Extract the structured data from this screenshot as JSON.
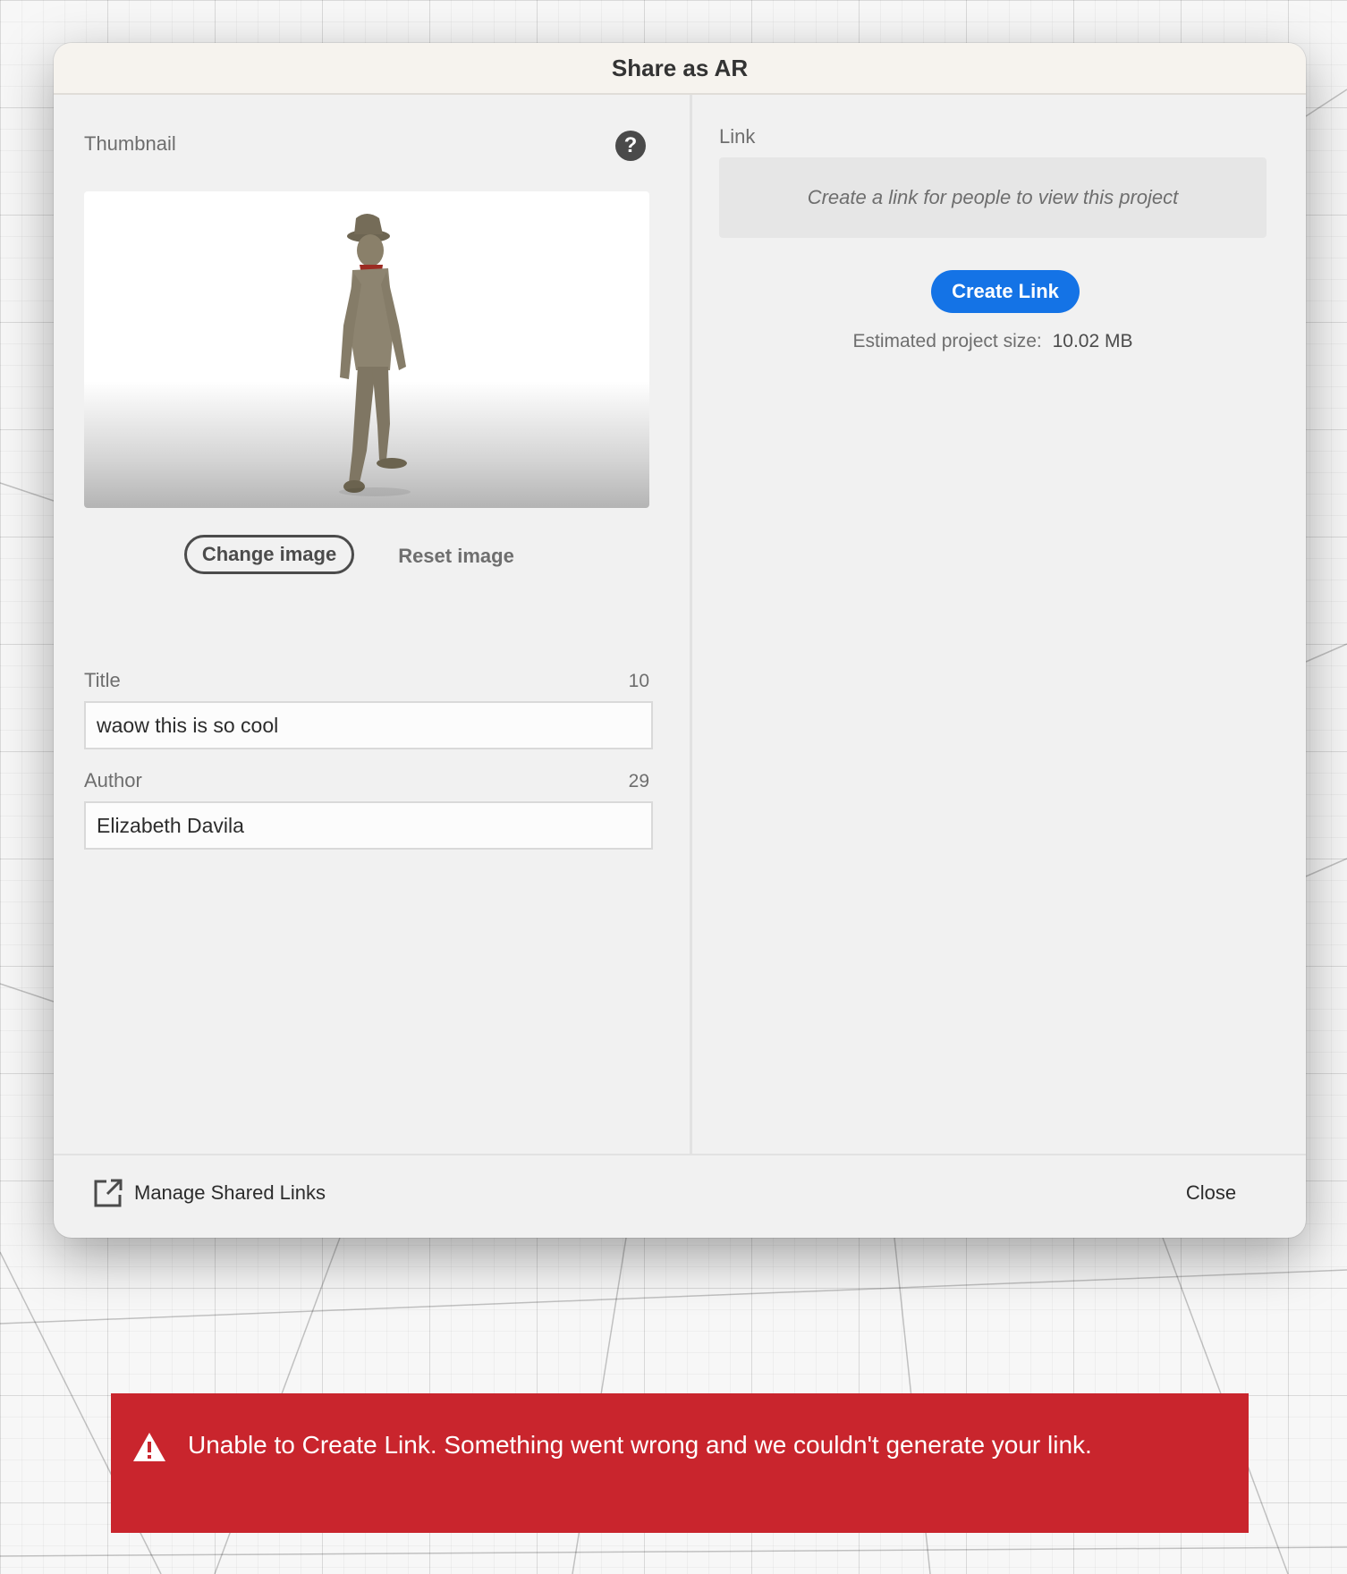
{
  "dialog": {
    "title": "Share as AR",
    "thumbnail_label": "Thumbnail",
    "help_icon": "question-mark-icon",
    "change_image_label": "Change image",
    "reset_image_label": "Reset image",
    "title_field": {
      "label": "Title",
      "remaining": "10",
      "value": "waow this is so cool"
    },
    "author_field": {
      "label": "Author",
      "remaining": "29",
      "value": "Elizabeth Davila"
    },
    "link": {
      "label": "Link",
      "placeholder": "Create a link for people to view this project",
      "create_button_label": "Create Link",
      "size_label": "Estimated project size:",
      "size_value": "10.02 MB"
    },
    "footer": {
      "manage_links_label": "Manage Shared Links",
      "manage_links_icon": "open-external-icon",
      "close_label": "Close"
    }
  },
  "toast": {
    "variant": "negative",
    "icon": "alert-triangle-icon",
    "message": "Unable to Create Link. Something went wrong and we couldn't generate your link."
  },
  "colors": {
    "accent": "#1473e6",
    "error": "#c9252d",
    "dialog_background": "#f1f1f1",
    "header_background": "#f6f3ee"
  }
}
